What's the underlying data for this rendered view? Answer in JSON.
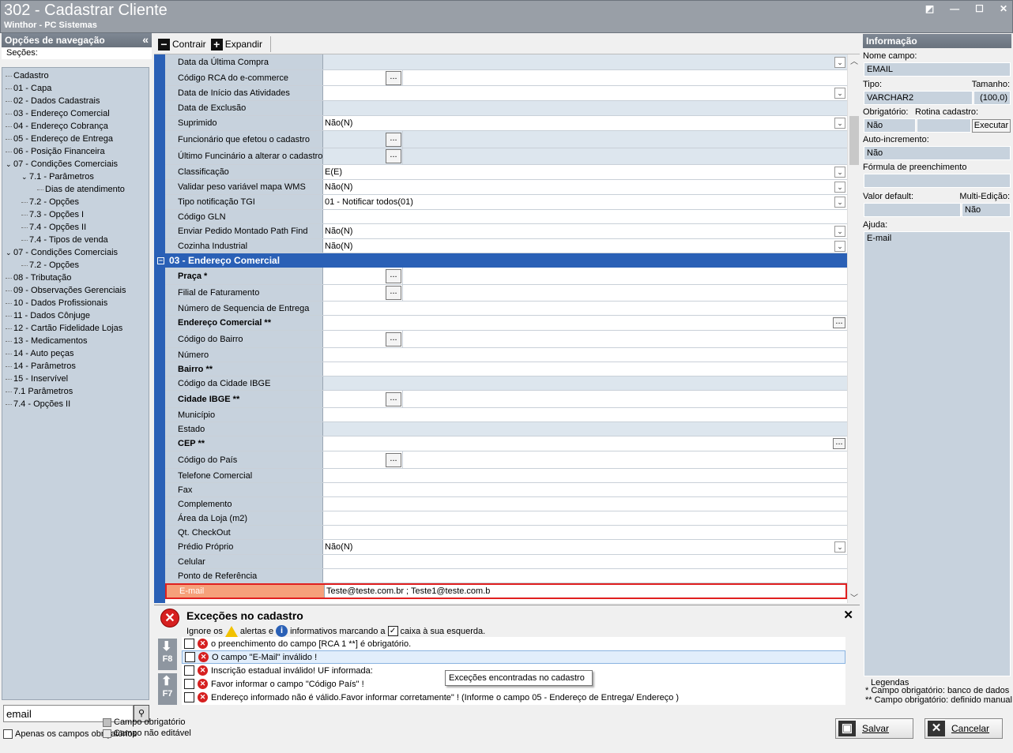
{
  "window": {
    "title": "302 - Cadastrar Cliente",
    "subtitle": "Winthor - PC Sistemas"
  },
  "nav": {
    "header": "Opções de navegação",
    "sections_label": "Seções:",
    "items": [
      {
        "label": "Cadastro",
        "lvl": 0
      },
      {
        "label": "01 - Capa",
        "lvl": 0
      },
      {
        "label": "02 - Dados Cadastrais",
        "lvl": 0
      },
      {
        "label": "03 - Endereço Comercial",
        "lvl": 0
      },
      {
        "label": "04 - Endereço Cobrança",
        "lvl": 0
      },
      {
        "label": "05 - Endereço de Entrega",
        "lvl": 0
      },
      {
        "label": "06 - Posição Financeira",
        "lvl": 0
      },
      {
        "label": "07 - Condições Comerciais",
        "lvl": 0,
        "exp": true
      },
      {
        "label": "7.1 - Parâmetros",
        "lvl": 1,
        "exp": true
      },
      {
        "label": "Dias de atendimento",
        "lvl": 2
      },
      {
        "label": "7.2 - Opções",
        "lvl": 1
      },
      {
        "label": "7.3 - Opções I",
        "lvl": 1
      },
      {
        "label": "7.4 - Opções II",
        "lvl": 1
      },
      {
        "label": "7.4 - Tipos de venda",
        "lvl": 1
      },
      {
        "label": "07 - Condições Comerciais",
        "lvl": 0,
        "exp": true
      },
      {
        "label": "7.2 - Opções",
        "lvl": 1
      },
      {
        "label": "08 - Tributação",
        "lvl": 0
      },
      {
        "label": "09 - Observações Gerenciais",
        "lvl": 0
      },
      {
        "label": "10 - Dados Profissionais",
        "lvl": 0
      },
      {
        "label": "11 - Dados Cônjuge",
        "lvl": 0
      },
      {
        "label": "12 - Cartão Fidelidade Lojas",
        "lvl": 0
      },
      {
        "label": "13 - Medicamentos",
        "lvl": 0
      },
      {
        "label": "14 - Auto peças",
        "lvl": 0
      },
      {
        "label": "14 - Parâmetros",
        "lvl": 0
      },
      {
        "label": "15 - Inservível",
        "lvl": 0
      },
      {
        "label": "7.1 Parâmetros",
        "lvl": 0
      },
      {
        "label": "7.4 - Opções II",
        "lvl": 0
      }
    ],
    "search_value": "email",
    "only_required_label": "Apenas os campos obrigatórios"
  },
  "toolbar": {
    "collapse_label": "Contrair",
    "expand_label": "Expandir"
  },
  "grid": {
    "rows_top": [
      {
        "label": "Data da Última Compra",
        "value": "",
        "ctl": "dd",
        "gray": true
      },
      {
        "label": "Código RCA do e-commerce",
        "value": "",
        "ctl": "ell"
      },
      {
        "label": "Data de Início das Atividades",
        "value": "",
        "ctl": "dd"
      },
      {
        "label": "Data de Exclusão",
        "value": "",
        "ctl": "",
        "gray": true
      },
      {
        "label": "Suprimido",
        "value": "Não(N)",
        "ctl": "dd"
      },
      {
        "label": "Funcionário que efetou o cadastro",
        "value": "",
        "ctl": "ell",
        "gray": true
      },
      {
        "label": "Último Funcinário a alterar o cadastro",
        "value": "",
        "ctl": "ell",
        "gray": true
      },
      {
        "label": "Classificação",
        "value": "E(E)",
        "ctl": "dd"
      },
      {
        "label": "Validar peso variável mapa WMS",
        "value": "Não(N)",
        "ctl": "dd"
      },
      {
        "label": "Tipo notificação TGI",
        "value": "01 - Notificar todos(01)",
        "ctl": "dd"
      },
      {
        "label": "Código GLN",
        "value": "",
        "ctl": ""
      },
      {
        "label": "Enviar Pedido Montado Path Find",
        "value": "Não(N)",
        "ctl": "dd"
      },
      {
        "label": "Cozinha Industrial",
        "value": "Não(N)",
        "ctl": "dd"
      }
    ],
    "section_label": "03 - Endereço Comercial",
    "rows_bottom": [
      {
        "label": "Praça *",
        "value": "",
        "ctl": "ell",
        "bold": true
      },
      {
        "label": "Filial de Faturamento",
        "value": "",
        "ctl": "ell"
      },
      {
        "label": "Número de Sequencia de Entrega",
        "value": "",
        "ctl": ""
      },
      {
        "label": "Endereço Comercial **",
        "value": "",
        "ctl": "ellr",
        "bold": true
      },
      {
        "label": "Código do Bairro",
        "value": "",
        "ctl": "ell"
      },
      {
        "label": "Número",
        "value": "",
        "ctl": ""
      },
      {
        "label": "Bairro **",
        "value": "",
        "ctl": "",
        "bold": true
      },
      {
        "label": "Código da Cidade IBGE",
        "value": "",
        "ctl": "",
        "gray": true
      },
      {
        "label": "Cidade IBGE **",
        "value": "",
        "ctl": "ell",
        "bold": true
      },
      {
        "label": "Município",
        "value": "",
        "ctl": ""
      },
      {
        "label": "Estado",
        "value": "",
        "ctl": "",
        "gray": true
      },
      {
        "label": "CEP **",
        "value": "",
        "ctl": "ellr",
        "bold": true
      },
      {
        "label": "Código do País",
        "value": "",
        "ctl": "ell"
      },
      {
        "label": "Telefone Comercial",
        "value": "",
        "ctl": ""
      },
      {
        "label": "Fax",
        "value": "",
        "ctl": ""
      },
      {
        "label": "Complemento",
        "value": "",
        "ctl": ""
      },
      {
        "label": "Área da Loja (m2)",
        "value": "",
        "ctl": ""
      },
      {
        "label": "Qt. CheckOut",
        "value": "",
        "ctl": ""
      },
      {
        "label": "Prédio Próprio",
        "value": "Não(N)",
        "ctl": "dd"
      },
      {
        "label": "Celular",
        "value": "",
        "ctl": ""
      },
      {
        "label": "Ponto de Referência",
        "value": "",
        "ctl": ""
      },
      {
        "label": "E-mail",
        "value": "Teste@teste.com.br ; Teste1@teste.com.b",
        "ctl": "",
        "err": true
      }
    ],
    "ellipsis": "..."
  },
  "exceptions": {
    "title": "Exceções no cadastro",
    "close": "✕",
    "sub_a": "Ignore os",
    "sub_b": "alertas e",
    "sub_c": "informativos marcando a",
    "sub_d": "caixa à sua esquerda.",
    "info_glyph": "i",
    "f8": "F8",
    "f7": "F7",
    "items": [
      "o preenchimento do campo [RCA 1 **] é obrigatório.",
      "O campo \"E-Mail\" inválido !",
      "Inscrição estadual inválido! UF informada:",
      "Favor informar o campo \"Código País\" !",
      "Endereço informado não é válido.Favor informar corretamente\" ! (Informe o campo 05 - Endereço de Entrega/ Endereço )"
    ],
    "tooltip": "Exceções encontradas no cadastro"
  },
  "info": {
    "header": "Informação",
    "nome_campo_label": "Nome campo:",
    "nome_campo": "EMAIL",
    "tipo_label": "Tipo:",
    "tamanho_label": "Tamanho:",
    "tipo": "VARCHAR2",
    "tamanho": "(100,0)",
    "obrigatorio_label": "Obrigatório:",
    "rotina_label": "Rotina cadastro:",
    "obrigatorio": "Não",
    "executar": "Executar",
    "auto_label": "Auto-incremento:",
    "auto": "Não",
    "formula_label": "Fórmula de preenchimento",
    "default_label": "Valor default:",
    "multi_label": "Multi-Edição:",
    "multi": "Não",
    "ajuda_label": "Ajuda:",
    "ajuda": "E-mail",
    "legendas": "Legendas",
    "leg1": "* Campo obrigatório: banco de dados",
    "leg2": "** Campo obrigatório: definido manual"
  },
  "footer": {
    "leg_required": "Campo obrigatório",
    "leg_noedit": "Campo não editável",
    "save": "Salvar",
    "cancel": "Cancelar"
  },
  "colors": {
    "accent": "#2a60b6",
    "label_bg": "#c7d2dd",
    "error": "#e02020"
  }
}
